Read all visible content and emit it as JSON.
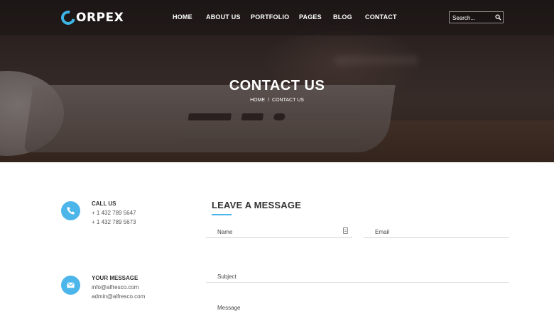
{
  "brand": {
    "logo_text": "ORPEX",
    "accent_color": "#4cb5ea"
  },
  "nav": {
    "items": [
      {
        "label": "HOME"
      },
      {
        "label": "ABOUT US"
      },
      {
        "label": "PORTFOLIO"
      },
      {
        "label": "PAGES"
      },
      {
        "label": "BLOG"
      },
      {
        "label": "CONTACT"
      }
    ],
    "search_placeholder": "Search..."
  },
  "hero": {
    "title": "CONTACT US",
    "breadcrumb": {
      "home": "HOME",
      "separator": "/",
      "current": "CONTACT US"
    }
  },
  "contact_info": [
    {
      "icon": "phone-icon",
      "title": "CALL US",
      "lines": [
        "+ 1 432 789 5647",
        "+ 1 432 789 5673"
      ]
    },
    {
      "icon": "envelope-icon",
      "title": "YOUR MESSAGE",
      "lines": [
        "info@alfresco.com",
        "admin@alfresco.com"
      ]
    }
  ],
  "form": {
    "title": "LEAVE A MESSAGE",
    "name_placeholder": "Name",
    "email_placeholder": "Email",
    "subject_placeholder": "Subject",
    "message_placeholder": "Message"
  }
}
